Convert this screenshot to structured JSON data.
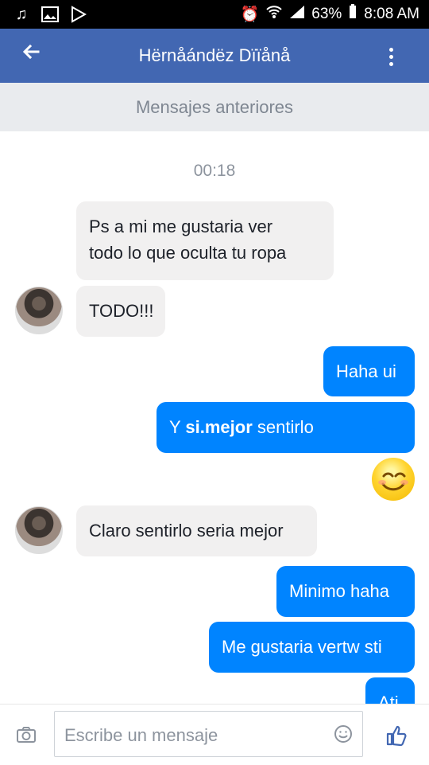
{
  "status_bar": {
    "battery": "63%",
    "time": "8:08 AM"
  },
  "header": {
    "contact_name": "Hërnåándëz Dïïånå"
  },
  "older_messages_label": "Mensajes anteriores",
  "timestamp": "00:18",
  "messages": [
    {
      "id": 1,
      "sender": "contact",
      "text_line1": "Ps a mi me gustaria ver",
      "text_line2": "todo lo que oculta tu ropa"
    },
    {
      "id": 2,
      "sender": "contact",
      "text": "TODO!!!"
    },
    {
      "id": 3,
      "sender": "me",
      "text": "Haha ui"
    },
    {
      "id": 4,
      "sender": "me",
      "text_prefix": "Y ",
      "text_bold": "si.mejor",
      "text_suffix": " sentirlo"
    },
    {
      "id": 5,
      "sender": "me",
      "emoji": "smiling-face-icon"
    },
    {
      "id": 6,
      "sender": "contact",
      "text": "Claro sentirlo seria mejor"
    },
    {
      "id": 7,
      "sender": "me",
      "text": "Minimo haha"
    },
    {
      "id": 8,
      "sender": "me",
      "text": "Me gustaria vertw sti"
    },
    {
      "id": 9,
      "sender": "me",
      "text": "Ati"
    }
  ],
  "composer": {
    "placeholder": "Escribe un mensaje"
  },
  "colors": {
    "statusbar": "#000000",
    "appbar": "#4267b2",
    "outgoing_bubble": "#0084ff",
    "incoming_bubble": "#f1f0f0",
    "older_messages_bg": "#e9ebee"
  }
}
